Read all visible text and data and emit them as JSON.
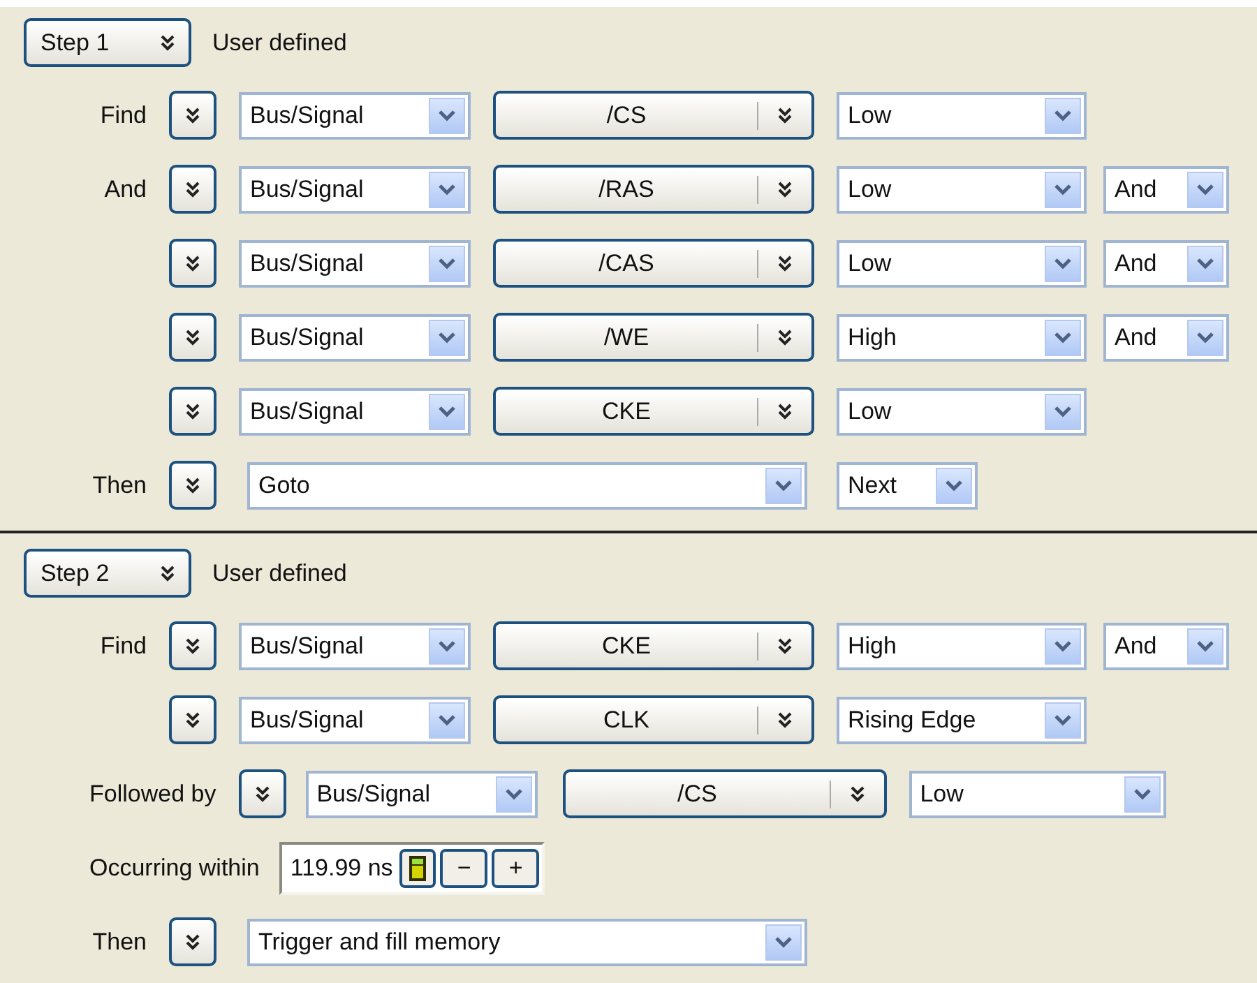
{
  "steps": [
    {
      "label": "Step 1",
      "mode": "User defined",
      "rows": [
        {
          "kind": "condition",
          "label": "Find",
          "source": "Bus/Signal",
          "signal": "/CS",
          "value": "Low"
        },
        {
          "kind": "condition",
          "label": "And",
          "source": "Bus/Signal",
          "signal": "/RAS",
          "value": "Low",
          "logic": "And"
        },
        {
          "kind": "condition",
          "source": "Bus/Signal",
          "signal": "/CAS",
          "value": "Low",
          "logic": "And"
        },
        {
          "kind": "condition",
          "source": "Bus/Signal",
          "signal": "/WE",
          "value": "High",
          "logic": "And"
        },
        {
          "kind": "condition",
          "source": "Bus/Signal",
          "signal": "CKE",
          "value": "Low"
        },
        {
          "kind": "then",
          "label": "Then",
          "action": "Goto",
          "target": "Next"
        }
      ]
    },
    {
      "label": "Step 2",
      "mode": "User defined",
      "rows": [
        {
          "kind": "condition",
          "label": "Find",
          "source": "Bus/Signal",
          "signal": "CKE",
          "value": "High",
          "logic": "And"
        },
        {
          "kind": "condition",
          "source": "Bus/Signal",
          "signal": "CLK",
          "value": "Rising Edge"
        },
        {
          "kind": "followed_by",
          "label": "Followed by",
          "source": "Bus/Signal",
          "signal": "/CS",
          "value": "Low"
        },
        {
          "kind": "within",
          "label": "Occurring within",
          "value": "119.99 ns",
          "minus": "−",
          "plus": "+"
        },
        {
          "kind": "then",
          "label": "Then",
          "action": "Trigger and fill memory"
        }
      ]
    }
  ]
}
